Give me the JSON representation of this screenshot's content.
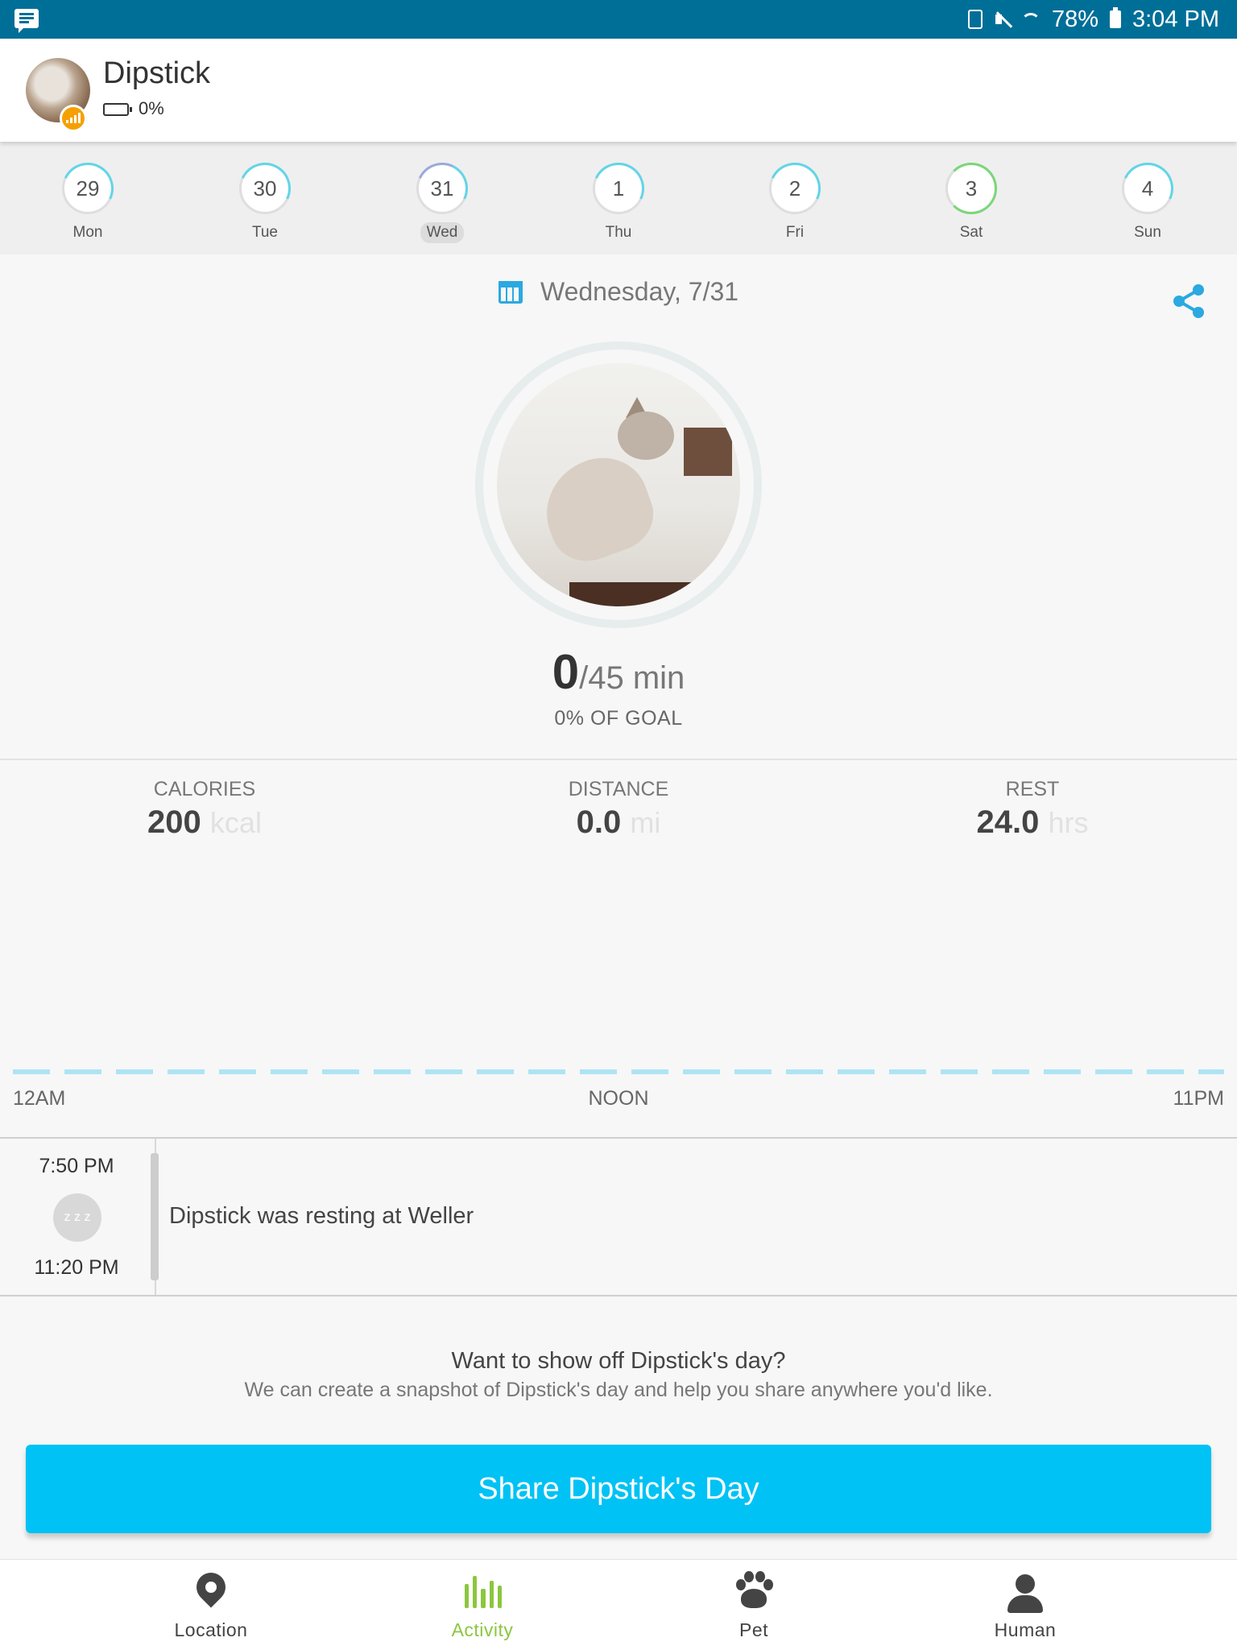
{
  "status_bar": {
    "battery_pct": "78%",
    "time": "3:04 PM",
    "icons": [
      "message-icon",
      "battery-saver-icon",
      "mute-icon",
      "wifi-icon",
      "battery-icon"
    ]
  },
  "header": {
    "pet_name": "Dipstick",
    "tracker_battery": "0%"
  },
  "week": [
    {
      "num": "29",
      "day": "Mon",
      "selected": false
    },
    {
      "num": "30",
      "day": "Tue",
      "selected": false
    },
    {
      "num": "31",
      "day": "Wed",
      "selected": true
    },
    {
      "num": "1",
      "day": "Thu",
      "selected": false
    },
    {
      "num": "2",
      "day": "Fri",
      "selected": false
    },
    {
      "num": "3",
      "day": "Sat",
      "selected": false
    },
    {
      "num": "4",
      "day": "Sun",
      "selected": false
    }
  ],
  "date_title": "Wednesday, 7/31",
  "activity": {
    "minutes": "0",
    "goal_text": "/45 min",
    "goal_pct": "0% OF GOAL"
  },
  "stats": {
    "calories": {
      "label": "CALORIES",
      "value": "200",
      "unit": "kcal"
    },
    "distance": {
      "label": "DISTANCE",
      "value": "0.0",
      "unit": "mi"
    },
    "rest": {
      "label": "REST",
      "value": "24.0",
      "unit": "hrs"
    }
  },
  "timeline": {
    "start": "12AM",
    "mid": "NOON",
    "end": "11PM"
  },
  "event": {
    "start_time": "7:50 PM",
    "end_time": "11:20 PM",
    "icon_text": "z z z",
    "text": "Dipstick was resting at Weller"
  },
  "share_prompt": {
    "title": "Want to show off Dipstick's day?",
    "subtitle": "We can create a snapshot of Dipstick's day and help you share anywhere you'd like.",
    "button": "Share Dipstick's Day"
  },
  "nav": {
    "location": "Location",
    "activity": "Activity",
    "pet": "Pet",
    "human": "Human",
    "active": "Activity"
  },
  "colors": {
    "status_bar": "#006f98",
    "accent_blue": "#00c2f4",
    "active_green": "#8cc63f",
    "badge_orange": "#f5a000"
  }
}
